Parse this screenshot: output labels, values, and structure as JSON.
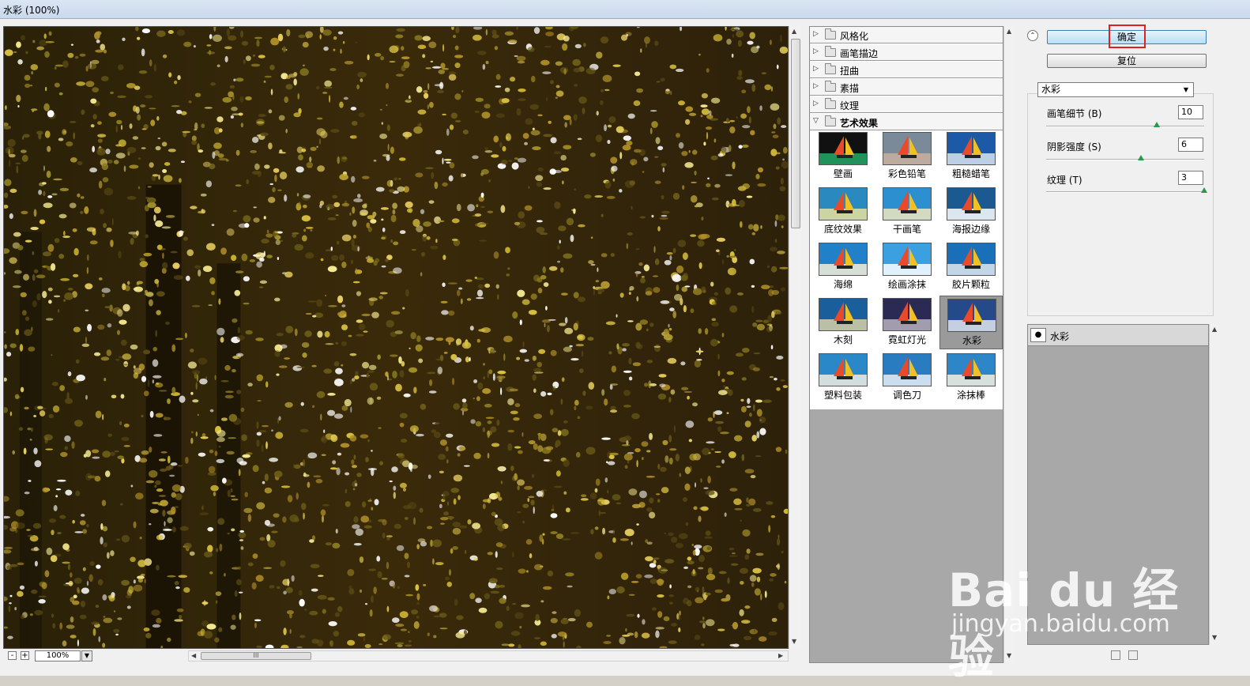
{
  "window": {
    "title": "水彩 (100%)"
  },
  "preview": {
    "zoom": "100%"
  },
  "filter_tree": {
    "categories": [
      {
        "label": "风格化",
        "open": false
      },
      {
        "label": "画笔描边",
        "open": false
      },
      {
        "label": "扭曲",
        "open": false
      },
      {
        "label": "素描",
        "open": false
      },
      {
        "label": "纹理",
        "open": false
      },
      {
        "label": "艺术效果",
        "open": true
      }
    ],
    "thumbnails": [
      {
        "label": "壁画",
        "selected": false
      },
      {
        "label": "彩色铅笔",
        "selected": false
      },
      {
        "label": "粗糙蜡笔",
        "selected": false
      },
      {
        "label": "底纹效果",
        "selected": false
      },
      {
        "label": "干画笔",
        "selected": false
      },
      {
        "label": "海报边缘",
        "selected": false
      },
      {
        "label": "海绵",
        "selected": false
      },
      {
        "label": "绘画涂抹",
        "selected": false
      },
      {
        "label": "胶片颗粒",
        "selected": false
      },
      {
        "label": "木刻",
        "selected": false
      },
      {
        "label": "霓虹灯光",
        "selected": false
      },
      {
        "label": "水彩",
        "selected": true
      },
      {
        "label": "塑料包装",
        "selected": false
      },
      {
        "label": "调色刀",
        "selected": false
      },
      {
        "label": "涂抹棒",
        "selected": false
      }
    ]
  },
  "controls": {
    "ok_label": "确定",
    "reset_label": "复位",
    "filter_select": "水彩",
    "params": [
      {
        "label": "画笔细节 (B)",
        "value": "10",
        "fraction": 0.7
      },
      {
        "label": "阴影强度 (S)",
        "value": "6",
        "fraction": 0.6
      },
      {
        "label": "纹理 (T)",
        "value": "3",
        "fraction": 1.0
      }
    ]
  },
  "layers": {
    "items": [
      {
        "name": "水彩",
        "visible": true
      }
    ]
  },
  "watermark": {
    "line1": "Bai du 经验",
    "line2": "jingyan.baidu.com"
  },
  "colors": {
    "highlight": "#e02020",
    "accent": "#3c7fb1"
  }
}
